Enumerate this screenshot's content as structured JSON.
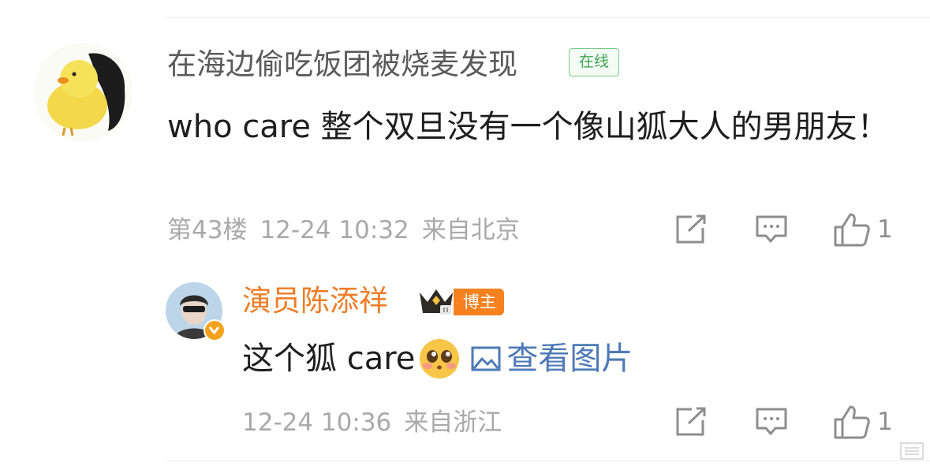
{
  "comment": {
    "username": "在海边偷吃饭团被烧麦发现",
    "online_badge": "在线",
    "text": "who care 整个双旦没有一个像山狐大人的男朋友！",
    "floor": "第43楼",
    "datetime": "12-24 10:32",
    "location": "来自北京",
    "like_count": "1"
  },
  "reply": {
    "username": "演员陈添祥",
    "badge": "博主",
    "text": "这个狐 care",
    "view_image_label": "查看图片",
    "datetime": "12-24 10:36",
    "location": "来自浙江",
    "like_count": "1"
  },
  "colors": {
    "online_green": "#3fa553",
    "reply_name_orange": "#ef7d27",
    "link_blue": "#4d7ab7",
    "meta_gray": "#a9a9a9"
  },
  "icons": [
    "share-icon",
    "reply-icon",
    "like-icon",
    "crown-icon",
    "emoji-face-icon",
    "image-icon",
    "verified-icon"
  ]
}
